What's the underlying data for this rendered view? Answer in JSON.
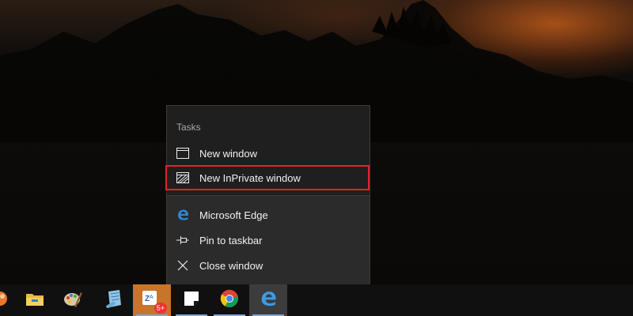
{
  "jumplist": {
    "header": "Tasks",
    "tasks": [
      {
        "label": "New window",
        "icon": "window-icon"
      },
      {
        "label": "New InPrivate window",
        "icon": "inprivate-window-icon",
        "highlighted": true
      }
    ],
    "app_items": [
      {
        "label": "Microsoft Edge",
        "icon": "edge-icon"
      },
      {
        "label": "Pin to taskbar",
        "icon": "pin-icon"
      },
      {
        "label": "Close window",
        "icon": "close-icon"
      }
    ],
    "highlight_color": "#e0242b"
  },
  "taskbar": {
    "items": [
      {
        "name": "partial-app-icon"
      },
      {
        "name": "file-explorer-icon"
      },
      {
        "name": "paint-icon"
      },
      {
        "name": "notepad-icon"
      },
      {
        "name": "word-app-icon",
        "badge": "5+"
      },
      {
        "name": "sticky-notes-icon"
      },
      {
        "name": "chrome-icon"
      },
      {
        "name": "edge-icon",
        "active": true
      }
    ],
    "accent": "#7da7d9"
  }
}
